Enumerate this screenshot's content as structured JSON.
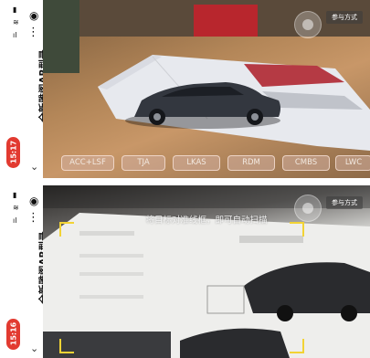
{
  "panel1": {
    "title": "全新雅阁AR型录",
    "time": "15:17",
    "participate_label": "参与方式",
    "features": [
      "ACC+LSF",
      "TJA",
      "LKAS",
      "RDM",
      "CMBS",
      "LWC"
    ]
  },
  "panel2": {
    "title": "全新雅阁AR型录",
    "time": "15:16",
    "participate_label": "参与方式",
    "hint": "将目标对准线框，即可自动扫描"
  },
  "colors": {
    "time_badge": "#e23a30",
    "scan_bracket": "#f2d335"
  },
  "icons": [
    "more-dots-icon",
    "target-icon",
    "chevron-down-icon",
    "signal-icon"
  ]
}
